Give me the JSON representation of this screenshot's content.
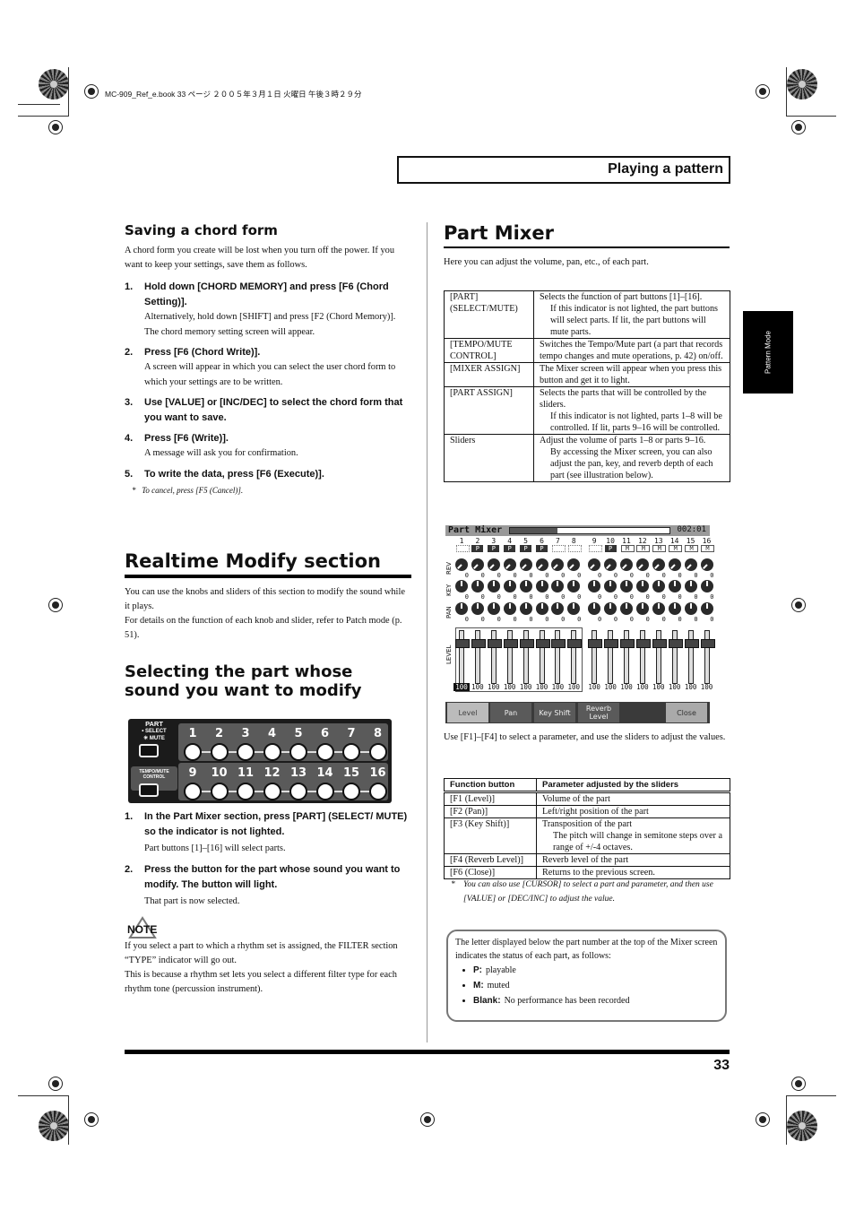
{
  "print_slug": "MC-909_Ref_e.book  33 ページ  ２００５年３月１日  火曜日  午後３時２９分",
  "header": {
    "section_title": "Playing a pattern"
  },
  "side_tab": {
    "label": "Pattern Mode"
  },
  "left": {
    "saving": {
      "heading": "Saving a chord form",
      "intro": "A chord form you create will be lost when you turn off the power. If you want to keep your settings, save them as follows.",
      "steps": [
        {
          "num": "1.",
          "text": "Hold down [CHORD MEMORY] and press [F6 (Chord Setting)].",
          "sub": [
            "Alternatively, hold down [SHIFT] and press [F2 (Chord Memory)].",
            "The chord memory setting screen will appear."
          ]
        },
        {
          "num": "2.",
          "text": "Press [F6 (Chord Write)].",
          "sub": [
            "A screen will appear in which you can select the user chord form to which your settings are to be written."
          ]
        },
        {
          "num": "3.",
          "text": "Use [VALUE] or [INC/DEC] to select the chord form that you want to save.",
          "sub": []
        },
        {
          "num": "4.",
          "text": "Press [F6 (Write)].",
          "sub": [
            "A message will ask you for confirmation."
          ]
        },
        {
          "num": "5.",
          "text": "To write the data, press [F6 (Execute)].",
          "sub": []
        }
      ],
      "note": "To cancel, press [F5 (Cancel)]."
    },
    "realtime": {
      "heading": "Realtime Modify section",
      "p1": "You can use the knobs and sliders of this section to modify the sound while it plays.",
      "p2": "For details on the function of each knob and slider, refer to Patch mode (p. 51)."
    },
    "selecting": {
      "heading": "Selecting the part whose sound you want to modify",
      "panel": {
        "part_label": "PART",
        "select_label": "• SELECT",
        "mute_label": "✳ MUTE",
        "tempo_label": "TEMPO/MUTE CONTROL",
        "row1": [
          "1",
          "2",
          "3",
          "4",
          "5",
          "6",
          "7",
          "8"
        ],
        "row2": [
          "9",
          "10",
          "11",
          "12",
          "13",
          "14",
          "15",
          "16"
        ]
      },
      "steps": [
        {
          "num": "1.",
          "text": "In the Part Mixer section, press [PART] (SELECT/ MUTE) so the indicator is not lighted.",
          "sub": [
            "Part buttons [1]–[16] will select parts."
          ]
        },
        {
          "num": "2.",
          "text": "Press the button for the part whose sound you want to modify. The button will light.",
          "sub": [
            "That part is now selected."
          ]
        }
      ],
      "note_label": "NOTE",
      "note_p1": "If you select a part to which a rhythm set is assigned, the FILTER section “TYPE” indicator will go out.",
      "note_p2": "This is because a rhythm set lets you select a different filter type for each rhythm tone (percussion instrument)."
    }
  },
  "right": {
    "heading": "Part Mixer",
    "intro": "Here you can adjust the volume, pan, etc., of each part.",
    "table1": [
      {
        "name": "[PART] (SELECT/MUTE)",
        "desc": "Selects the function of part buttons [1]–[16].",
        "detail": "If this indicator is not lighted, the part buttons will select parts. If lit, the part buttons will mute parts."
      },
      {
        "name": "[TEMPO/MUTE CONTROL]",
        "desc": "Switches the Tempo/Mute part (a part that records tempo changes and mute operations, p. 42) on/off.",
        "detail": ""
      },
      {
        "name": "[MIXER ASSIGN]",
        "desc": "The Mixer screen will appear when you press this button and get it to light.",
        "detail": ""
      },
      {
        "name": "[PART ASSIGN]",
        "desc": "Selects the parts that will be controlled by the sliders.",
        "detail": "If this indicator is not lighted, parts 1–8 will be controlled. If lit, parts 9–16 will be controlled."
      },
      {
        "name": "Sliders",
        "desc": "Adjust the volume of parts 1–8 or parts 9–16.",
        "detail": "By accessing the Mixer screen, you can also adjust the pan, key, and reverb depth of each part (see illustration below)."
      }
    ],
    "mixer": {
      "title": "Part Mixer",
      "position": "002:01",
      "progress": 0.3,
      "parts": [
        "1",
        "2",
        "3",
        "4",
        "5",
        "6",
        "7",
        "8",
        "9",
        "10",
        "11",
        "12",
        "13",
        "14",
        "15",
        "16"
      ],
      "status": [
        "",
        "P",
        "P",
        "P",
        "P",
        "P",
        "",
        "",
        "",
        "P",
        "M",
        "M",
        "M",
        "M",
        "M",
        "M"
      ],
      "row_labels": {
        "rev": "REV",
        "key": "KEY",
        "pan": "PAN",
        "level": "LEVEL"
      },
      "rev": [
        0,
        0,
        0,
        0,
        0,
        0,
        0,
        0,
        0,
        0,
        0,
        0,
        0,
        0,
        0,
        0
      ],
      "key": [
        0,
        0,
        0,
        0,
        0,
        0,
        0,
        0,
        0,
        0,
        0,
        0,
        0,
        0,
        0,
        0
      ],
      "pan": [
        0,
        0,
        0,
        0,
        0,
        0,
        0,
        0,
        0,
        0,
        0,
        0,
        0,
        0,
        0,
        0
      ],
      "level": [
        100,
        100,
        100,
        100,
        100,
        100,
        100,
        100,
        100,
        100,
        100,
        100,
        100,
        100,
        100,
        100
      ],
      "tabs": [
        "Level",
        "Pan",
        "Key Shift",
        "Reverb Level"
      ],
      "close": "Close"
    },
    "after_mixer": "Use [F1]–[F4] to select a parameter, and use the sliders to adjust the values.",
    "table2": {
      "headers": [
        "Function button",
        "Parameter adjusted by the sliders"
      ],
      "rows": [
        {
          "btn": "[F1 (Level)]",
          "desc": "Volume of the part",
          "detail": ""
        },
        {
          "btn": "[F2 (Pan)]",
          "desc": "Left/right position of the part",
          "detail": ""
        },
        {
          "btn": "[F3 (Key Shift)]",
          "desc": "Transposition of the part",
          "detail": "The pitch will change in semitone steps over a range of +/-4 octaves."
        },
        {
          "btn": "[F4 (Reverb Level)]",
          "desc": "Reverb level of the part",
          "detail": ""
        },
        {
          "btn": "[F6 (Close)]",
          "desc": "Returns to the previous screen.",
          "detail": ""
        }
      ]
    },
    "note": "You can also use [CURSOR] to select a part and parameter, and then use [VALUE] or [DEC/INC] to adjust the value.",
    "infobox": {
      "intro": "The letter displayed below the part number at the top of the Mixer screen indicates the status of each part, as follows:",
      "items": [
        {
          "key": "P:",
          "text": "playable"
        },
        {
          "key": "M:",
          "text": "muted"
        },
        {
          "key": "Blank:",
          "text": "No performance has been recorded"
        }
      ]
    }
  },
  "footer": {
    "page_number": "33"
  }
}
